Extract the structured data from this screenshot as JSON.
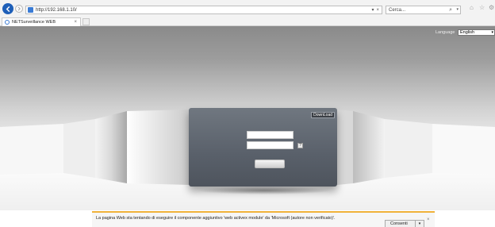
{
  "browser": {
    "url": "http://192.168.1.10/",
    "search_placeholder": "Cerca...",
    "tab_title": "NETSurveillance WEB",
    "tab_close": "×",
    "refresh_glyph": "×",
    "search_glyph": "⌕",
    "dropdown_glyph": "▾",
    "home_glyph": "⌂",
    "favorites_glyph": "☆",
    "settings_glyph": "⚙"
  },
  "page": {
    "language_label": "Language",
    "language_value": "English",
    "download_label": "DownLoad",
    "help_label": "?"
  },
  "notification": {
    "message": "La pagina Web sta tentando di eseguire il componente aggiuntivo 'web activex  module' da 'Microsoft (autore non verificato)'.",
    "allow_label": "Consenti",
    "close_glyph": "×"
  },
  "colors": {
    "accent": "#1e5fb8",
    "notification_border": "#f0b23a",
    "panel": "#5d636c"
  }
}
